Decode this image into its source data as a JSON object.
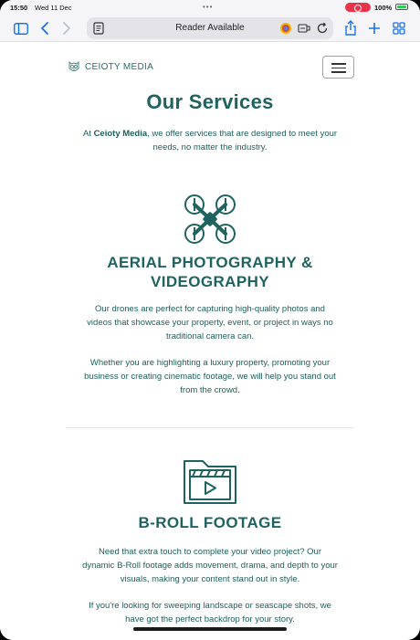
{
  "status_bar": {
    "time": "15:50",
    "date": "Wed 11 Dec",
    "dots": "•••",
    "battery": "100%"
  },
  "toolbar": {
    "address_text": "Reader Available",
    "icons": [
      "sidebar-icon",
      "back-icon",
      "forward-icon",
      "reader-icon",
      "extension-icon",
      "translate-icon",
      "reload-icon",
      "share-icon",
      "new-tab-icon",
      "tabs-icon"
    ]
  },
  "header": {
    "logo_text": "CEIOTY MEDIA"
  },
  "page": {
    "title": "Our Services",
    "intro_before": "At ",
    "intro_brand": "Ceioty Media",
    "intro_after": ", we offer services that are designed to meet your needs, no matter the industry."
  },
  "services": [
    {
      "icon": "drone-icon",
      "title": "AERIAL PHOTOGRAPHY & VIDEOGRAPHY",
      "paragraphs": [
        "Our drones are perfect for capturing high-quality photos and videos that showcase your property, event, or project in ways no traditional camera can.",
        "Whether you are highlighting a luxury property, promoting your business or creating cinematic footage, we will help you stand out from the crowd."
      ]
    },
    {
      "icon": "film-folder-icon",
      "title": "B-ROLL FOOTAGE",
      "paragraphs": [
        "Need that extra touch to complete your video project? Our dynamic B-Roll footage adds movement, drama, and depth to your visuals, making your content stand out in style.",
        "If you're looking for sweeping landscape or seascape shots, we have got the perfect backdrop for your story."
      ]
    }
  ],
  "colors": {
    "brand_teal": "#1f6360",
    "status_record": "#e8334a",
    "toolbar_bg": "#f5f5f7"
  }
}
